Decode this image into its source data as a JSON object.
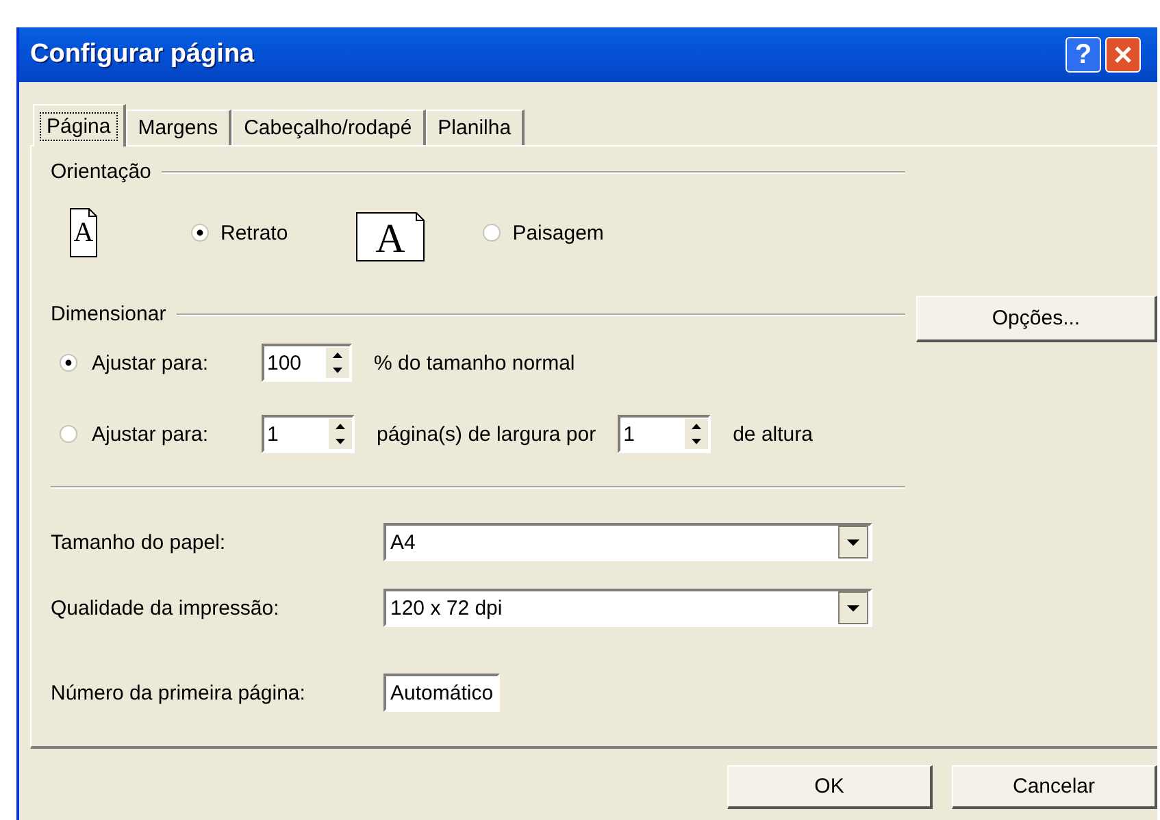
{
  "window": {
    "title": "Configurar página",
    "help": "?"
  },
  "tabs": [
    {
      "label": "Página",
      "selected": true
    },
    {
      "label": "Margens",
      "selected": false
    },
    {
      "label": "Cabeçalho/rodapé",
      "selected": false
    },
    {
      "label": "Planilha",
      "selected": false
    }
  ],
  "orientation": {
    "heading": "Orientação",
    "options": [
      {
        "kind": "portrait",
        "icon_letter": "A",
        "label": "Retrato",
        "selected": true
      },
      {
        "kind": "landscape",
        "icon_letter": "A",
        "label": "Paisagem",
        "selected": false
      }
    ]
  },
  "scaling": {
    "heading": "Dimensionar",
    "options": [
      {
        "kind": "percent",
        "label": "Ajustar para:",
        "selected": true,
        "value": "100",
        "suffix": "% do tamanho normal"
      },
      {
        "kind": "pages",
        "label": "Ajustar para:",
        "selected": false,
        "wide": "1",
        "middle": "página(s) de largura por",
        "tall": "1",
        "suffix": "de altura"
      }
    ]
  },
  "options_button": {
    "label": "Opções..."
  },
  "fields": [
    {
      "kind": "dropdown",
      "label": "Tamanho do papel:",
      "value": "A4"
    },
    {
      "kind": "dropdown",
      "label": "Qualidade da impressão:",
      "value": "120 x 72 dpi"
    },
    {
      "kind": "text",
      "label": "Número da primeira página:",
      "value": "Automático"
    }
  ],
  "buttons": [
    {
      "label": "OK"
    },
    {
      "label": "Cancelar"
    }
  ]
}
